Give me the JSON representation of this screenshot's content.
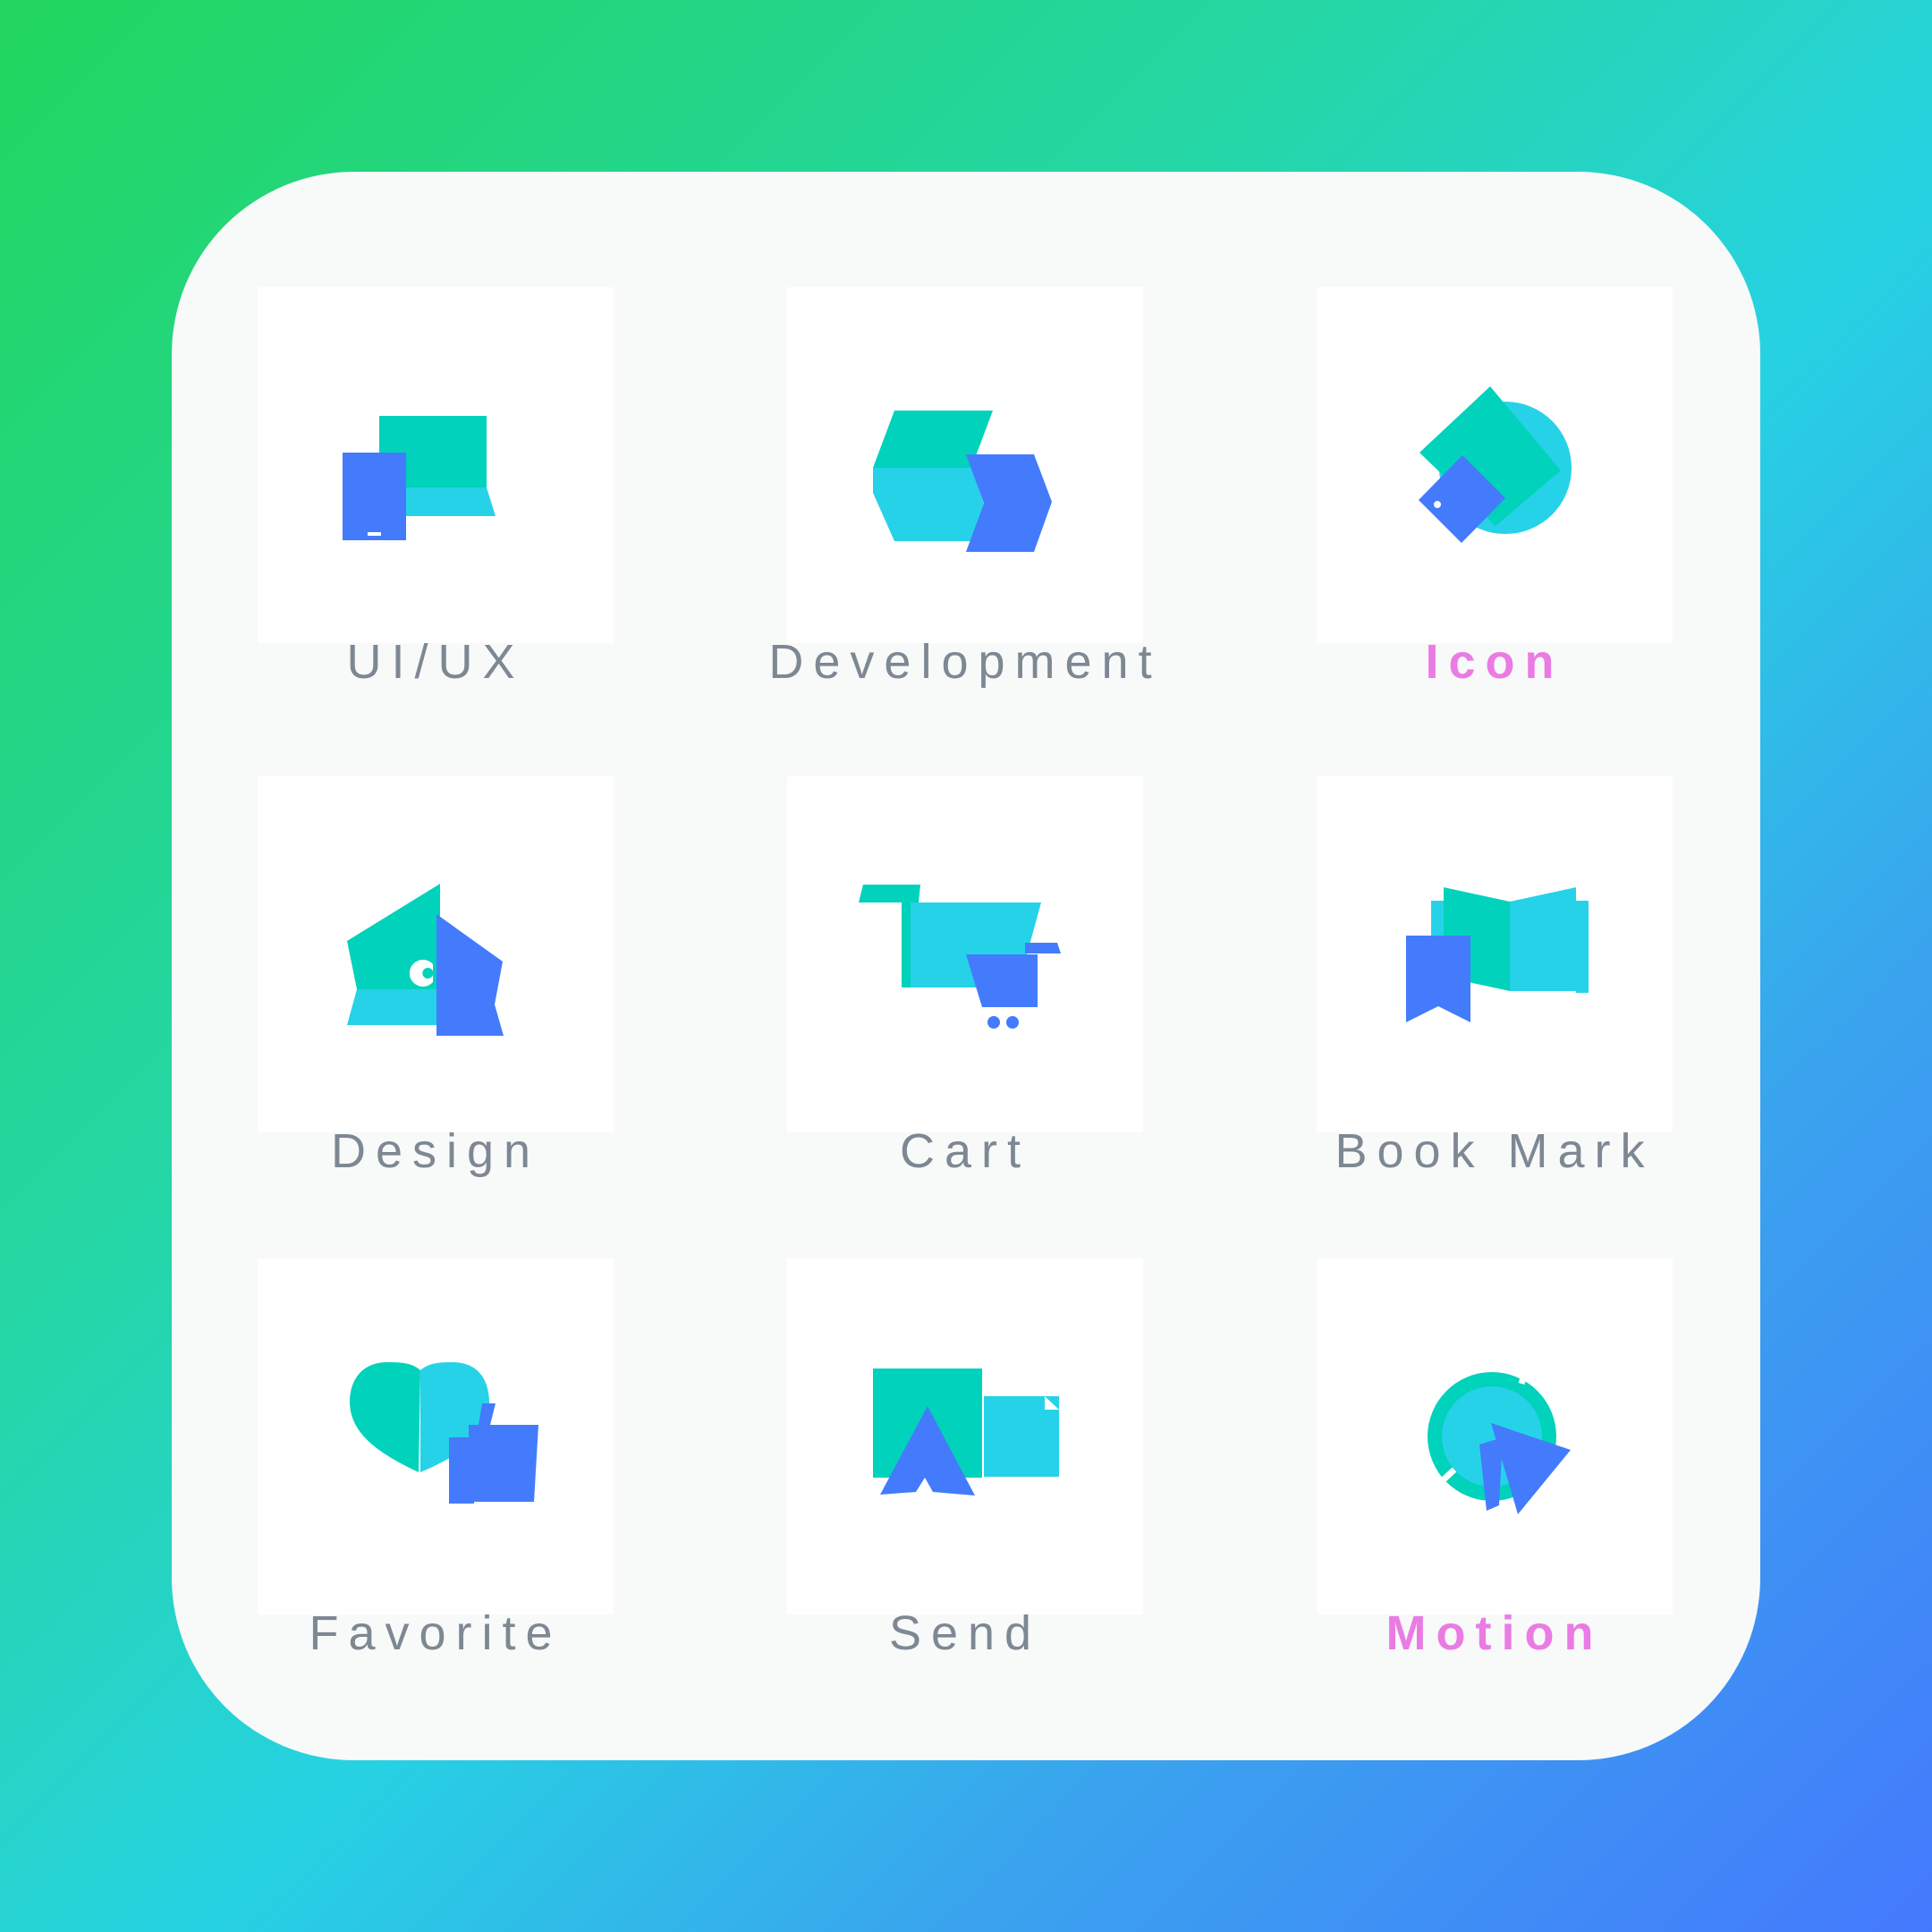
{
  "colors": {
    "teal": "#01d2bb",
    "cyan": "#26d2e8",
    "blue": "#437bfc",
    "label": "#7d8893",
    "accent_label": "#ea7be4"
  },
  "tiles": [
    {
      "label": "UI/UX",
      "icon": "ui-ux-icon",
      "highlighted": false
    },
    {
      "label": "Development",
      "icon": "development-icon",
      "highlighted": false
    },
    {
      "label": "Icon",
      "icon": "icon-icon",
      "highlighted": true
    },
    {
      "label": "Design",
      "icon": "design-icon",
      "highlighted": false
    },
    {
      "label": "Cart",
      "icon": "cart-icon",
      "highlighted": false
    },
    {
      "label": "Book Mark",
      "icon": "bookmark-icon",
      "highlighted": false
    },
    {
      "label": "Favorite",
      "icon": "favorite-icon",
      "highlighted": false
    },
    {
      "label": "Send",
      "icon": "send-icon",
      "highlighted": false
    },
    {
      "label": "Motion",
      "icon": "motion-icon",
      "highlighted": true
    }
  ]
}
